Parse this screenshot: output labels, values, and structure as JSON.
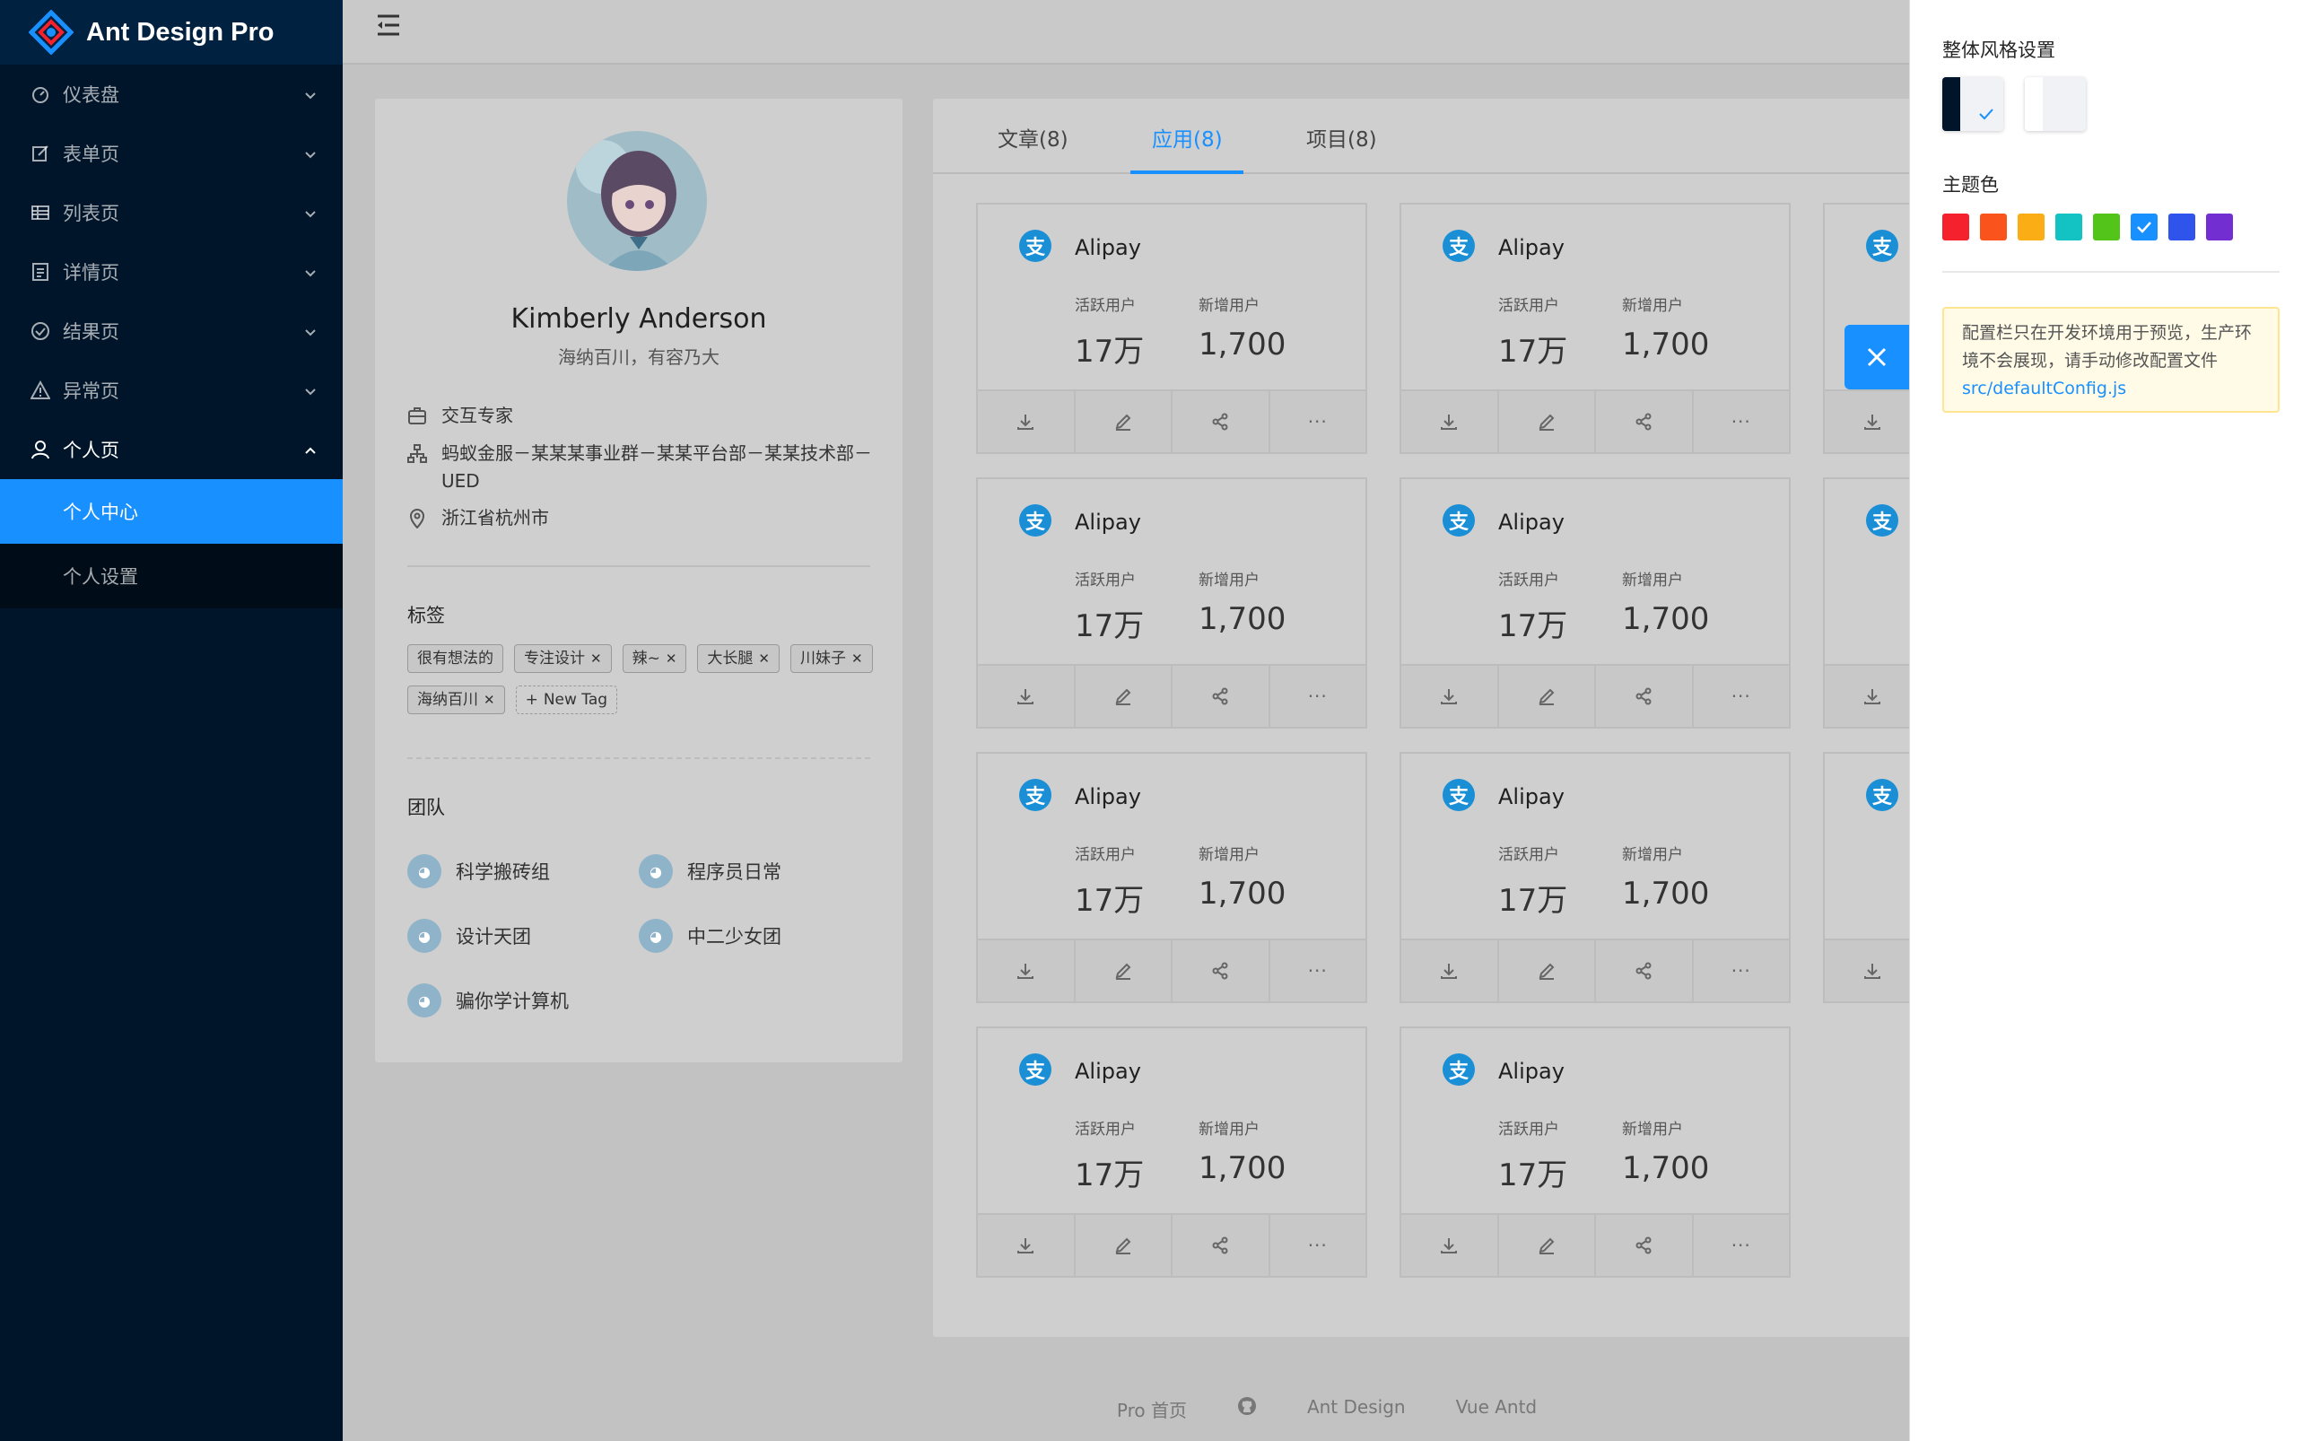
{
  "app": {
    "title": "Ant Design Pro"
  },
  "sidebar": {
    "items": [
      {
        "label": "仪表盘",
        "icon": "dashboard-icon"
      },
      {
        "label": "表单页",
        "icon": "form-icon"
      },
      {
        "label": "列表页",
        "icon": "table-icon"
      },
      {
        "label": "详情页",
        "icon": "profile-icon"
      },
      {
        "label": "结果页",
        "icon": "check-circle-icon"
      },
      {
        "label": "异常页",
        "icon": "warning-icon"
      },
      {
        "label": "个人页",
        "icon": "user-icon"
      }
    ],
    "sub_items": [
      {
        "label": "个人中心",
        "active": true
      },
      {
        "label": "个人设置",
        "active": false
      }
    ]
  },
  "profile": {
    "name": "Kimberly Anderson",
    "bio": "海纳百川，有容乃大",
    "title": "交互专家",
    "org": "蚂蚁金服－某某某事业群－某某平台部－某某技术部－UED",
    "location": "浙江省杭州市",
    "tags_title": "标签",
    "tags": [
      "很有想法的",
      "专注设计",
      "辣~",
      "大长腿",
      "川妹子",
      "海纳百川"
    ],
    "new_tag_label": "New Tag",
    "team_title": "团队",
    "teams": [
      "科学搬砖组",
      "程序员日常",
      "设计天团",
      "中二少女团",
      "骗你学计算机"
    ]
  },
  "tabs": [
    {
      "label": "文章(8)",
      "active": false
    },
    {
      "label": "应用(8)",
      "active": true
    },
    {
      "label": "项目(8)",
      "active": false
    }
  ],
  "app_card": {
    "logo_char": "支",
    "title": "Alipay",
    "active_label": "活跃用户",
    "active_value": "17万",
    "new_label": "新增用户",
    "new_value": "1,700"
  },
  "footer": {
    "links": [
      "Pro 首页",
      "Ant Design",
      "Vue Antd"
    ]
  },
  "settings": {
    "style_title": "整体风格设置",
    "theme_title": "主题色",
    "colors": [
      "#f5222d",
      "#fa541c",
      "#faad14",
      "#13c2c2",
      "#52c41a",
      "#1890ff",
      "#2f54eb",
      "#722ed1"
    ],
    "selected_color": "#1890ff",
    "alert_text": "配置栏只在开发环境用于预览，生产环境不会展现，请手动修改配置文件 ",
    "alert_link": "src/defaultConfig.js"
  }
}
